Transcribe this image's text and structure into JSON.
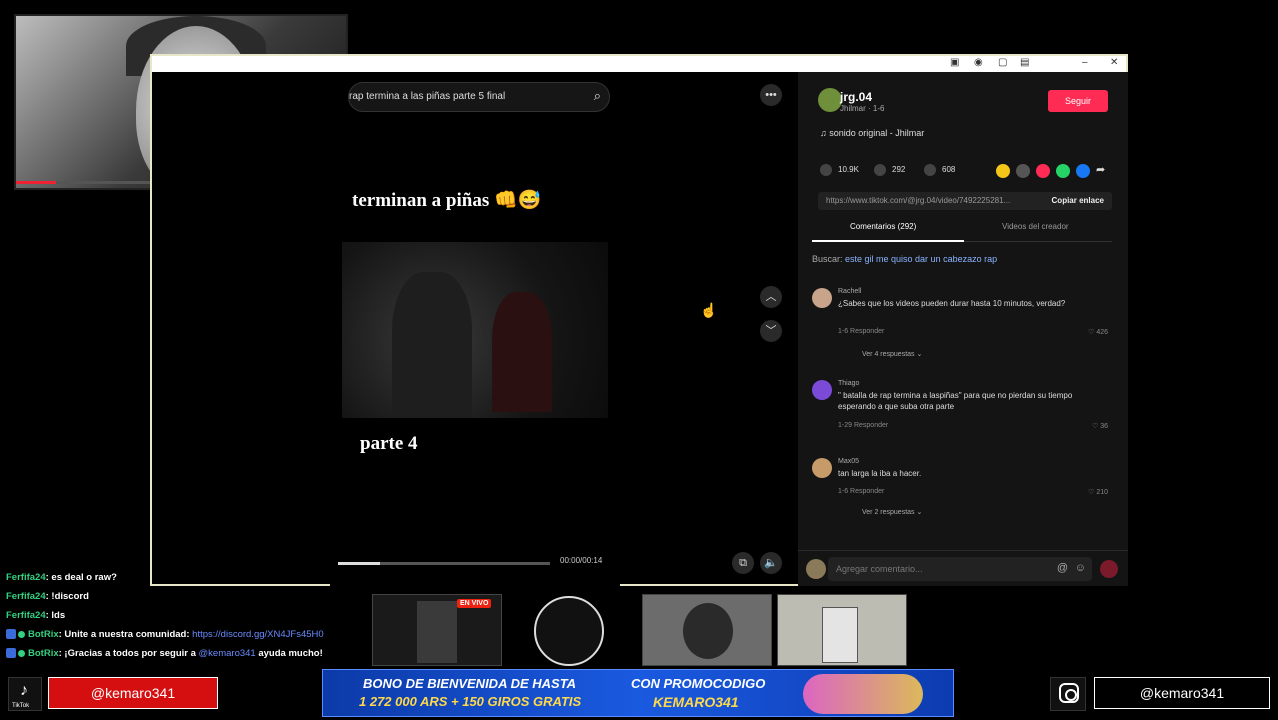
{
  "browser": {
    "search_query": "rap termina a las piñas parte 5 final",
    "window_controls": [
      "–",
      "✕"
    ]
  },
  "video": {
    "caption_top": "terminan a piñas 👊😅",
    "caption_bottom": "parte 4",
    "time": "00:00/00:14",
    "progress_fraction": 0.2
  },
  "author": {
    "username": "jrg.04",
    "meta": "Jhilmar · 1-6",
    "follow_label": "Seguir",
    "sound": "♫ sonido original - Jhilmar"
  },
  "stats": {
    "likes": "10.9K",
    "comments": "292",
    "saves": "608"
  },
  "share_colors": [
    "#f5c518",
    "#555555",
    "#fe2c55",
    "#25d366",
    "#1877f2"
  ],
  "link": {
    "url": "https://www.tiktok.com/@jrg.04/video/7492225281...",
    "copy_label": "Copiar enlace"
  },
  "tabs": {
    "comments": "Comentarios (292)",
    "creator_videos": "Videos del creador"
  },
  "search_suggestion": {
    "prefix": "Buscar: ",
    "query": "este gil me quiso dar un cabezazo rap"
  },
  "comments": [
    {
      "name": "Rachell",
      "text": "¿Sabes que los videos pueden durar hasta 10 minutos, verdad?",
      "meta": "1-6    Responder",
      "likes": "♡ 426",
      "replies": "Ver 4 respuestas ⌄",
      "avatar_color": "#c7a48a"
    },
    {
      "name": "Thiago",
      "text": "\" batalla de rap termina a laspiñas\" para que no pierdan su tiempo esperando a que suba otra parte",
      "meta": "1-29    Responder",
      "likes": "♡ 36",
      "replies": "",
      "avatar_color": "#7b4bd8"
    },
    {
      "name": "Max05",
      "text": "tan larga la iba a hacer.",
      "meta": "1-6    Responder",
      "likes": "♡ 210",
      "replies": "Ver 2 respuestas ⌄",
      "avatar_color": "#c79a6a"
    }
  ],
  "composer": {
    "placeholder": "Agregar comentario..."
  },
  "chat": [
    {
      "user": "Ferfifa24",
      "msg": ": es deal o raw?"
    },
    {
      "user": "Ferfifa24",
      "msg": ": !discord"
    },
    {
      "user": "Ferfifa24",
      "msg": ": lds"
    },
    {
      "user": "BotRix",
      "msg": ": Unite a nuestra comunidad: ",
      "link": "https://discord.gg/XN4JFs45H0"
    },
    {
      "user": "BotRix",
      "msg": ": ¡Gracias a todos por seguir a ",
      "link": "@kemaro341",
      "tail": " ayuda mucho!"
    }
  ],
  "thumbs": {
    "live_badge": "EN VIVO"
  },
  "footer": {
    "tiktok_label": "TikTok",
    "handle_left": "@kemaro341",
    "handle_right": "@kemaro341",
    "banner_line1": "BONO DE BIENVENIDA DE HASTA",
    "banner_line2": "1 272 000 ARS + 150 GIROS GRATIS",
    "banner_line3": "CON PROMOCODIGO",
    "banner_line4": "KEMARO341"
  }
}
